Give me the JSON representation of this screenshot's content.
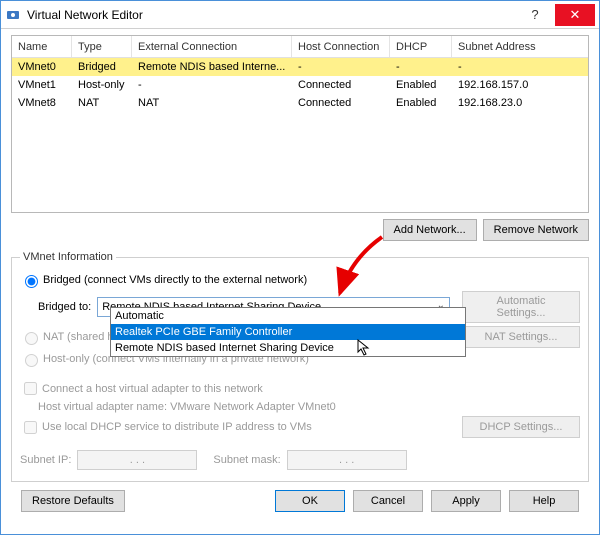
{
  "window": {
    "title": "Virtual Network Editor"
  },
  "table": {
    "headers": {
      "name": "Name",
      "type": "Type",
      "ext": "External Connection",
      "host": "Host Connection",
      "dhcp": "DHCP",
      "subnet": "Subnet Address"
    },
    "rows": [
      {
        "name": "VMnet0",
        "type": "Bridged",
        "ext": "Remote NDIS based Interne...",
        "host": "-",
        "dhcp": "-",
        "subnet": "-"
      },
      {
        "name": "VMnet1",
        "type": "Host-only",
        "ext": "-",
        "host": "Connected",
        "dhcp": "Enabled",
        "subnet": "192.168.157.0"
      },
      {
        "name": "VMnet8",
        "type": "NAT",
        "ext": "NAT",
        "host": "Connected",
        "dhcp": "Enabled",
        "subnet": "192.168.23.0"
      }
    ]
  },
  "buttons": {
    "add_network": "Add Network...",
    "remove_network": "Remove Network",
    "auto_settings": "Automatic Settings...",
    "nat_settings": "NAT Settings...",
    "dhcp_settings": "DHCP Settings...",
    "restore": "Restore Defaults",
    "ok": "OK",
    "cancel": "Cancel",
    "apply": "Apply",
    "help": "Help"
  },
  "group": {
    "legend": "VMnet Information",
    "radio_bridged": "Bridged (connect VMs directly to the external network)",
    "bridged_to": "Bridged to:",
    "combo_value": "Remote NDIS based Internet Sharing Device",
    "options": {
      "o1": "Automatic",
      "o2": "Realtek PCIe GBE Family Controller",
      "o3": "Remote NDIS based Internet Sharing Device"
    },
    "radio_nat": "NAT (shared host's IP address with VMs)",
    "radio_host": "Host-only (connect VMs internally in a private network)",
    "check_adapter": "Connect a host virtual adapter to this network",
    "adapter_hint": "Host virtual adapter name: VMware Network Adapter VMnet0",
    "check_dhcp": "Use local DHCP service to distribute IP address to VMs",
    "subnet_ip": "Subnet IP:",
    "subnet_mask": "Subnet mask:",
    "dots": ".       .       ."
  }
}
